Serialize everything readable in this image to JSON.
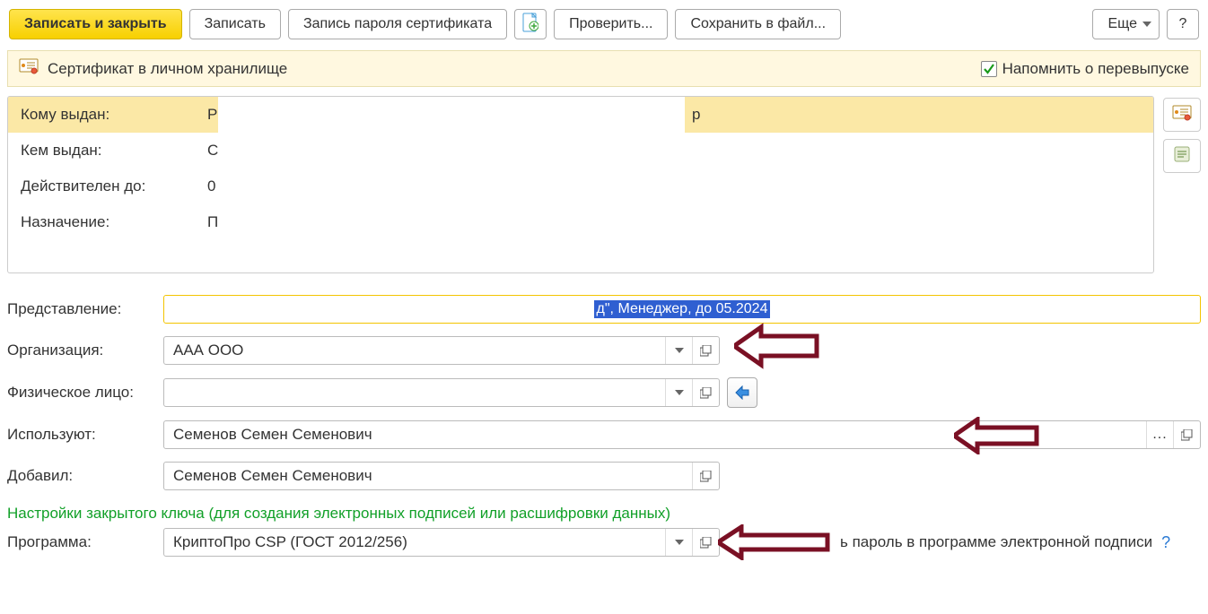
{
  "toolbar": {
    "save_and_close": "Записать и закрыть",
    "save": "Записать",
    "record_password": "Запись пароля сертификата",
    "check": "Проверить...",
    "save_to_file": "Сохранить в файл...",
    "more": "Еще",
    "help": "?"
  },
  "notice": {
    "text": "Сертификат в личном хранилище",
    "remind_label": "Напомнить о перевыпуске",
    "remind_checked": true
  },
  "info": {
    "issued_to_label": "Кому выдан:",
    "issued_to_v1": "Р",
    "issued_to_v2": "р",
    "issued_by_label": "Кем выдан:",
    "issued_by_value": "С",
    "valid_to_label": "Действителен до:",
    "valid_to_value": "0",
    "purpose_label": "Назначение:",
    "purpose_value": "П"
  },
  "form": {
    "presentation_label": "Представление:",
    "presentation_value": "д\", Менеджер, до 05.2024",
    "org_label": "Организация:",
    "org_value": "ААА ООО",
    "person_label": "Физическое лицо:",
    "person_value": "",
    "users_label": "Используют:",
    "users_value": "Семенов Семен Семенович",
    "added_by_label": "Добавил:",
    "added_by_value": "Семенов Семен Семенович",
    "section_title": "Настройки закрытого ключа (для создания электронных подписей или расшифровки данных)",
    "program_label": "Программа:",
    "program_value": "КриптоПро CSP (ГОСТ 2012/256)",
    "program_trailing": "ь пароль в программе электронной подписи",
    "program_help": "?"
  },
  "icons": {
    "add_page": "add-page-icon",
    "certificate": "certificate-icon",
    "page_lines": "page-lines-icon",
    "checkmark": "checkmark-icon",
    "left_arrow": "left-arrow-icon"
  }
}
